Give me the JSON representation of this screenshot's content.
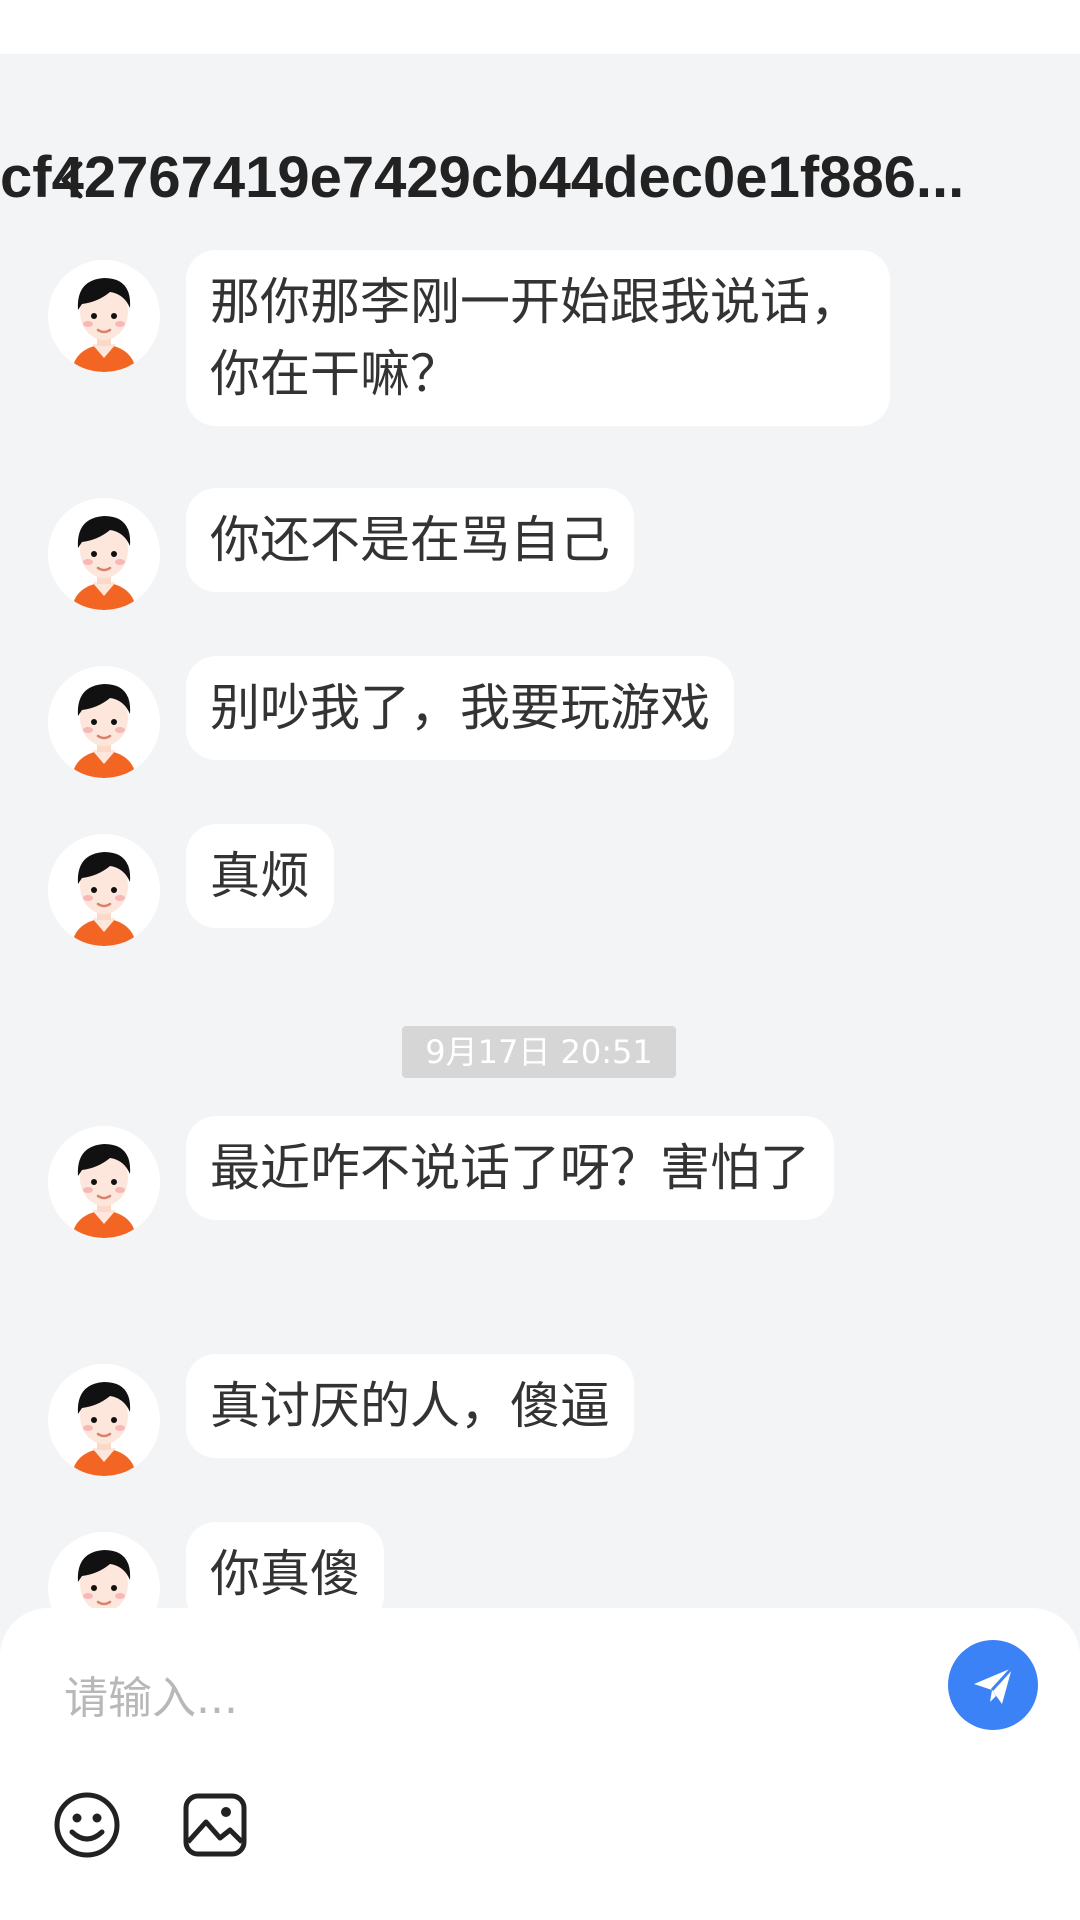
{
  "header": {
    "title": "cf42767419e7429cb44dec0e1f886...",
    "back_icon": "chevron-left-icon"
  },
  "messages": [
    {
      "type": "text",
      "text": "那你那李刚一开始跟我说话，你在干嘛？"
    },
    {
      "type": "text",
      "text": "你还不是在骂自己"
    },
    {
      "type": "text",
      "text": "别吵我了，我要玩游戏"
    },
    {
      "type": "text",
      "text": "真烦"
    },
    {
      "type": "time",
      "text": "9月17日 20:51"
    },
    {
      "type": "text",
      "text": "最近咋不说话了呀？害怕了"
    },
    {
      "type": "text",
      "text": "真讨厌的人，傻逼"
    },
    {
      "type": "text",
      "text": "你真傻"
    }
  ],
  "composer": {
    "placeholder": "请输入...",
    "send_icon": "send-icon",
    "emoji_icon": "emoji-icon",
    "image_icon": "image-icon"
  },
  "colors": {
    "background": "#f3f4f6",
    "bubble": "#ffffff",
    "accent": "#3b82f6",
    "timestamp_bg": "#d6d6d6",
    "avatar_shirt": "#f26522"
  }
}
